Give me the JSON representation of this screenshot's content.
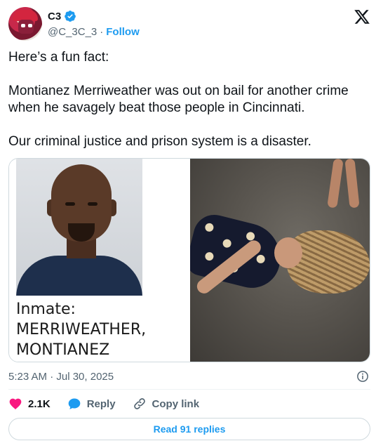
{
  "author": {
    "display_name": "C3",
    "handle": "@C_3C_3",
    "separator": "·",
    "follow_label": "Follow",
    "verified_icon": "verified-badge-icon"
  },
  "brand": {
    "logo_icon": "x-logo-icon"
  },
  "tweet": {
    "paragraphs": [
      "Here’s a fun fact:",
      "Montianez Merriweather was out on bail for another crime when he savagely beat those people in Cincinnati.",
      "Our criminal justice and prison system is a disaster."
    ]
  },
  "media": {
    "left_image": {
      "label_line1": "Inmate:",
      "label_line2": "MERRIWEATHER,",
      "label_line3": "MONTIANEZ"
    },
    "right_image": {}
  },
  "meta": {
    "timestamp": "5:23 AM · Jul 30, 2025",
    "info_icon": "info-icon"
  },
  "actions": {
    "like_count": "2.1K",
    "reply_label": "Reply",
    "copy_link_label": "Copy link"
  },
  "footer": {
    "read_replies_label": "Read 91 replies"
  },
  "colors": {
    "accent": "#1d9bf0",
    "like": "#f91880",
    "text": "#0f1419",
    "secondary": "#536471",
    "border": "#cfd9de"
  }
}
